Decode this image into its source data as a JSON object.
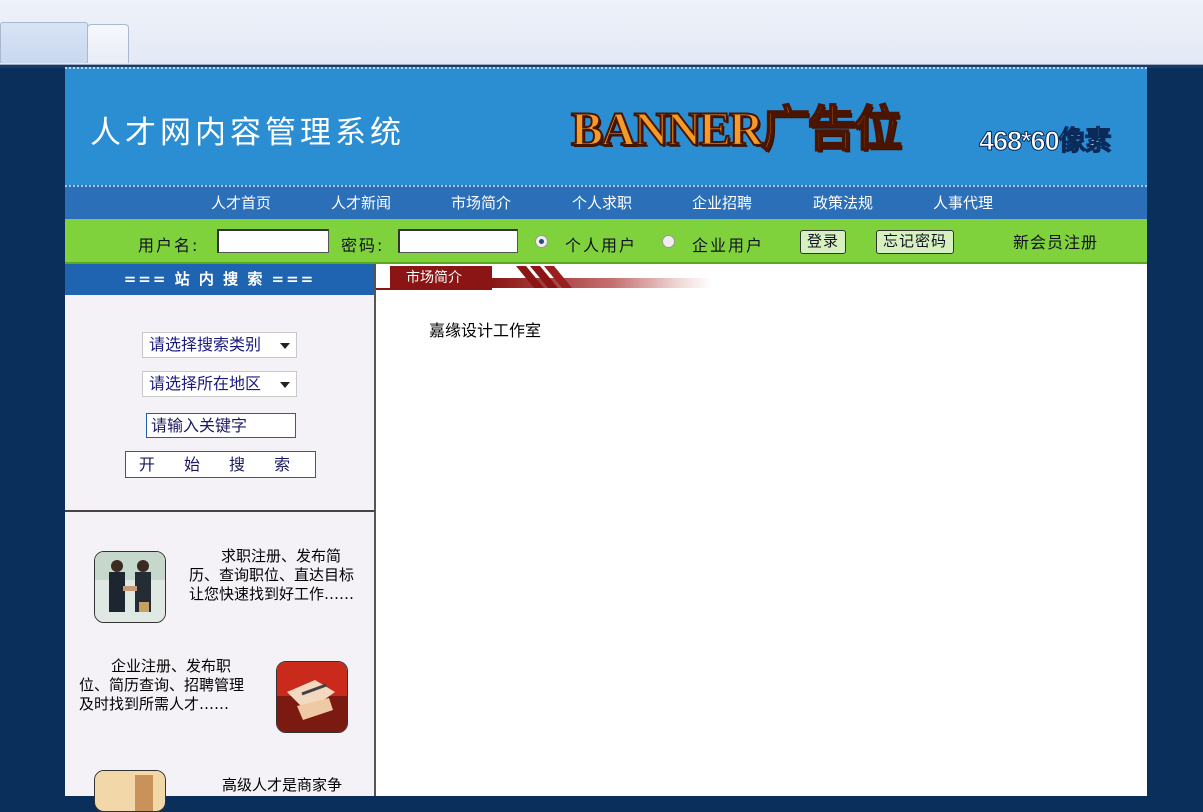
{
  "site": {
    "title": "人才网内容管理系统",
    "banner": "BANNER广告位",
    "banner_size": "468*60像素"
  },
  "nav": [
    "人才首页",
    "人才新闻",
    "市场简介",
    "个人求职",
    "企业招聘",
    "政策法规",
    "人事代理"
  ],
  "login": {
    "username_label": "用户名:",
    "password_label": "密码:",
    "user_type_personal": "个人用户",
    "user_type_company": "企业用户",
    "selected_user_type": "个人用户",
    "login_button": "登录",
    "forgot_button": "忘记密码",
    "register_link": "新会员注册"
  },
  "search": {
    "heading": "=== 站 内 搜 索 ===",
    "category_select": "请选择搜索类别",
    "region_select": "请选择所在地区",
    "keyword_value": "请输入关键字",
    "submit_label": "开 始 搜 索"
  },
  "promos": [
    {
      "text": "求职注册、发布简历、查询职位、直达目标让您快速找到好工作……"
    },
    {
      "text": "企业注册、发布职位、简历查询、招聘管理及时找到所需人才……"
    },
    {
      "text": "高级人才是商家争"
    }
  ],
  "main": {
    "section_title": "市场简介",
    "content": "嘉缘设计工作室"
  },
  "colors": {
    "header_blue": "#2b8ed3",
    "nav_blue": "#2a6fb8",
    "login_green": "#7fd23b",
    "section_red": "#8b1515",
    "page_bg": "#0a2f5a"
  }
}
